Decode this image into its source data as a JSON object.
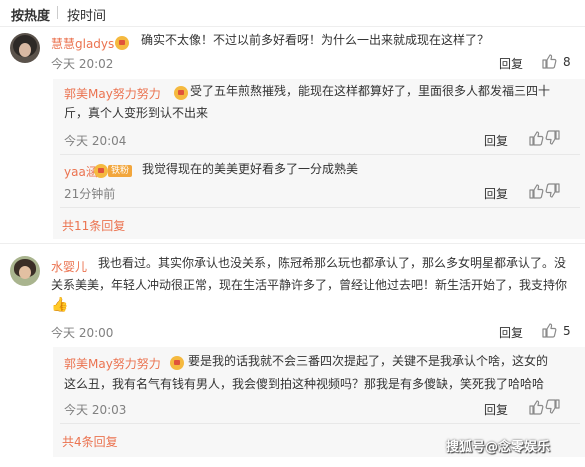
{
  "sort_tabs": {
    "hot": "按热度",
    "time": "按时间"
  },
  "labels": {
    "reply": "回复"
  },
  "comments": [
    {
      "username": "慧慧gladys",
      "text": "确实不太像！不过以前多好看呀！为什么一出来就成现在这样了？",
      "time": "今天 20:02",
      "likes": "8",
      "replies": [
        {
          "username": "郭美May努力努力",
          "line1": "受了五年煎熬摧残，能现在这样都算好了，里面很多人都发福三四十",
          "line2": "斤，真个人变形到认不出来",
          "time": "今天 20:04"
        },
        {
          "username": "yaa涵",
          "badge": "铁粉",
          "text": "我觉得现在的美美更好看多了一分成熟美",
          "time": "21分钟前"
        }
      ],
      "more_replies": "共11条回复"
    },
    {
      "username": "水婴儿",
      "line1": "我也看过。其实你承认也没关系，陈冠希那么玩也都承认了，那么多女明星都承认了。没",
      "line2": "关系美美，年轻人冲动很正常，现在生活平静许多了，曾经让他过去吧！新生活开始了，我支持你",
      "emoji": "👍",
      "time": "今天 20:00",
      "likes": "5",
      "replies": [
        {
          "username": "郭美May努力努力",
          "line1": "要是我的话我就不会三番四次提起了，关键不是我承认个啥，这女的",
          "line2": "这么丑，我有名气有钱有男人，我会傻到拍这种视频吗？那我是有多傻缺，笑死我了哈哈哈",
          "time": "今天 20:03"
        }
      ],
      "more_replies": "共4条回复"
    }
  ],
  "watermark": "搜狐号@念零娱乐"
}
